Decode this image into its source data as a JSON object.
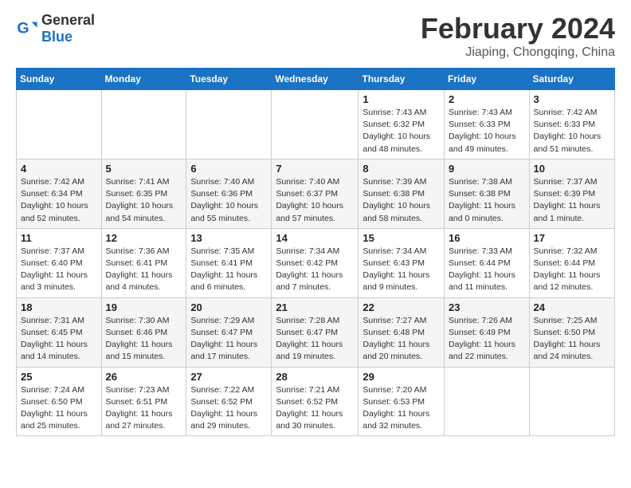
{
  "logo": {
    "general": "General",
    "blue": "Blue"
  },
  "header": {
    "month": "February 2024",
    "location": "Jiaping, Chongqing, China"
  },
  "weekdays": [
    "Sunday",
    "Monday",
    "Tuesday",
    "Wednesday",
    "Thursday",
    "Friday",
    "Saturday"
  ],
  "weeks": [
    [
      {
        "day": "",
        "info": ""
      },
      {
        "day": "",
        "info": ""
      },
      {
        "day": "",
        "info": ""
      },
      {
        "day": "",
        "info": ""
      },
      {
        "day": "1",
        "info": "Sunrise: 7:43 AM\nSunset: 6:32 PM\nDaylight: 10 hours and 48 minutes."
      },
      {
        "day": "2",
        "info": "Sunrise: 7:43 AM\nSunset: 6:33 PM\nDaylight: 10 hours and 49 minutes."
      },
      {
        "day": "3",
        "info": "Sunrise: 7:42 AM\nSunset: 6:33 PM\nDaylight: 10 hours and 51 minutes."
      }
    ],
    [
      {
        "day": "4",
        "info": "Sunrise: 7:42 AM\nSunset: 6:34 PM\nDaylight: 10 hours and 52 minutes."
      },
      {
        "day": "5",
        "info": "Sunrise: 7:41 AM\nSunset: 6:35 PM\nDaylight: 10 hours and 54 minutes."
      },
      {
        "day": "6",
        "info": "Sunrise: 7:40 AM\nSunset: 6:36 PM\nDaylight: 10 hours and 55 minutes."
      },
      {
        "day": "7",
        "info": "Sunrise: 7:40 AM\nSunset: 6:37 PM\nDaylight: 10 hours and 57 minutes."
      },
      {
        "day": "8",
        "info": "Sunrise: 7:39 AM\nSunset: 6:38 PM\nDaylight: 10 hours and 58 minutes."
      },
      {
        "day": "9",
        "info": "Sunrise: 7:38 AM\nSunset: 6:38 PM\nDaylight: 11 hours and 0 minutes."
      },
      {
        "day": "10",
        "info": "Sunrise: 7:37 AM\nSunset: 6:39 PM\nDaylight: 11 hours and 1 minute."
      }
    ],
    [
      {
        "day": "11",
        "info": "Sunrise: 7:37 AM\nSunset: 6:40 PM\nDaylight: 11 hours and 3 minutes."
      },
      {
        "day": "12",
        "info": "Sunrise: 7:36 AM\nSunset: 6:41 PM\nDaylight: 11 hours and 4 minutes."
      },
      {
        "day": "13",
        "info": "Sunrise: 7:35 AM\nSunset: 6:41 PM\nDaylight: 11 hours and 6 minutes."
      },
      {
        "day": "14",
        "info": "Sunrise: 7:34 AM\nSunset: 6:42 PM\nDaylight: 11 hours and 7 minutes."
      },
      {
        "day": "15",
        "info": "Sunrise: 7:34 AM\nSunset: 6:43 PM\nDaylight: 11 hours and 9 minutes."
      },
      {
        "day": "16",
        "info": "Sunrise: 7:33 AM\nSunset: 6:44 PM\nDaylight: 11 hours and 11 minutes."
      },
      {
        "day": "17",
        "info": "Sunrise: 7:32 AM\nSunset: 6:44 PM\nDaylight: 11 hours and 12 minutes."
      }
    ],
    [
      {
        "day": "18",
        "info": "Sunrise: 7:31 AM\nSunset: 6:45 PM\nDaylight: 11 hours and 14 minutes."
      },
      {
        "day": "19",
        "info": "Sunrise: 7:30 AM\nSunset: 6:46 PM\nDaylight: 11 hours and 15 minutes."
      },
      {
        "day": "20",
        "info": "Sunrise: 7:29 AM\nSunset: 6:47 PM\nDaylight: 11 hours and 17 minutes."
      },
      {
        "day": "21",
        "info": "Sunrise: 7:28 AM\nSunset: 6:47 PM\nDaylight: 11 hours and 19 minutes."
      },
      {
        "day": "22",
        "info": "Sunrise: 7:27 AM\nSunset: 6:48 PM\nDaylight: 11 hours and 20 minutes."
      },
      {
        "day": "23",
        "info": "Sunrise: 7:26 AM\nSunset: 6:49 PM\nDaylight: 11 hours and 22 minutes."
      },
      {
        "day": "24",
        "info": "Sunrise: 7:25 AM\nSunset: 6:50 PM\nDaylight: 11 hours and 24 minutes."
      }
    ],
    [
      {
        "day": "25",
        "info": "Sunrise: 7:24 AM\nSunset: 6:50 PM\nDaylight: 11 hours and 25 minutes."
      },
      {
        "day": "26",
        "info": "Sunrise: 7:23 AM\nSunset: 6:51 PM\nDaylight: 11 hours and 27 minutes."
      },
      {
        "day": "27",
        "info": "Sunrise: 7:22 AM\nSunset: 6:52 PM\nDaylight: 11 hours and 29 minutes."
      },
      {
        "day": "28",
        "info": "Sunrise: 7:21 AM\nSunset: 6:52 PM\nDaylight: 11 hours and 30 minutes."
      },
      {
        "day": "29",
        "info": "Sunrise: 7:20 AM\nSunset: 6:53 PM\nDaylight: 11 hours and 32 minutes."
      },
      {
        "day": "",
        "info": ""
      },
      {
        "day": "",
        "info": ""
      }
    ]
  ]
}
